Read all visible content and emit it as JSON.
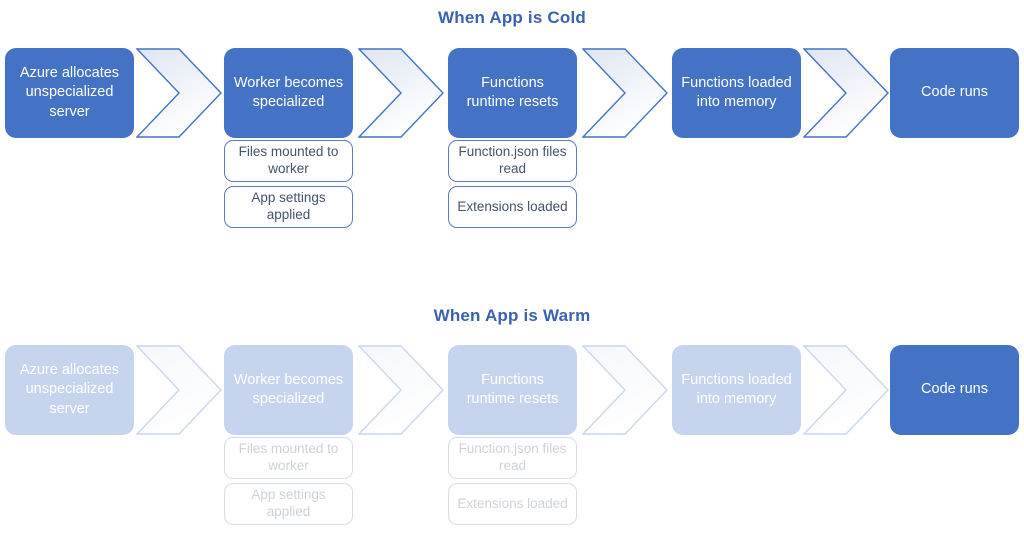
{
  "diagram": {
    "type": "process-flow",
    "colors": {
      "stage_fill": "#4472C4",
      "stage_text": "#FFFFFF",
      "sub_border": "#5B7CC4",
      "sub_text": "#44546A",
      "title_text": "#3A62B0",
      "arrow_outline": "#4472C4",
      "background": "#FFFFFF"
    },
    "sections": [
      {
        "id": "cold",
        "title": "When App is Cold",
        "faded": false,
        "stages": [
          {
            "label": "Azure allocates unspecialized server",
            "active": true,
            "substeps": []
          },
          {
            "label": "Worker becomes specialized",
            "active": true,
            "substeps": [
              "Files mounted to worker",
              "App settings applied"
            ]
          },
          {
            "label": "Functions runtime resets",
            "active": true,
            "substeps": [
              "Function.json files read",
              "Extensions loaded"
            ]
          },
          {
            "label": "Functions loaded into memory",
            "active": true,
            "substeps": []
          },
          {
            "label": "Code runs",
            "active": true,
            "substeps": []
          }
        ]
      },
      {
        "id": "warm",
        "title": "When App is Warm",
        "faded": true,
        "stages": [
          {
            "label": "Azure allocates unspecialized server",
            "active": false,
            "substeps": []
          },
          {
            "label": "Worker becomes specialized",
            "active": false,
            "substeps": [
              "Files mounted to worker",
              "App settings applied"
            ]
          },
          {
            "label": "Functions runtime resets",
            "active": false,
            "substeps": [
              "Function.json files read",
              "Extensions loaded"
            ]
          },
          {
            "label": "Functions loaded into memory",
            "active": false,
            "substeps": []
          },
          {
            "label": "Code runs",
            "active": true,
            "substeps": []
          }
        ]
      }
    ],
    "arrow_icon": "chevron-right-icon"
  }
}
